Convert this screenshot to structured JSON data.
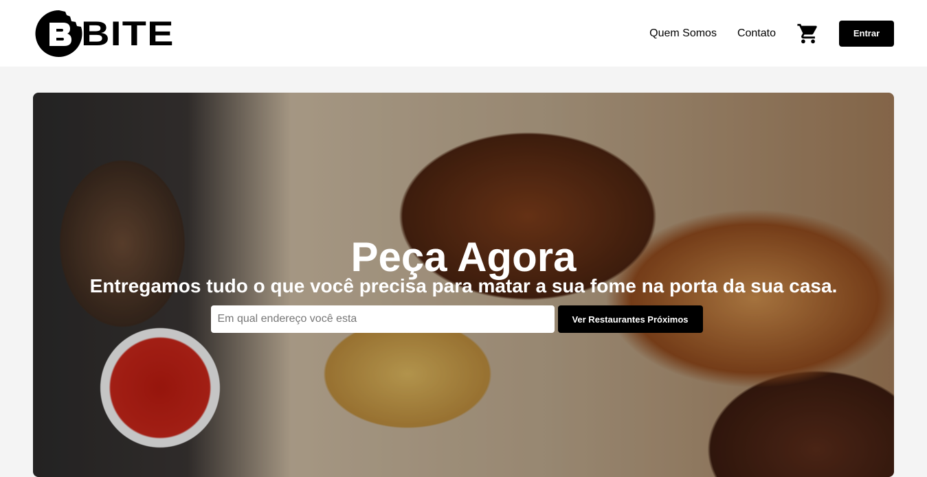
{
  "header": {
    "logo_text": "BITE",
    "nav": [
      {
        "label": "Quem Somos"
      },
      {
        "label": "Contato"
      }
    ],
    "cart_icon": "shopping-cart-icon",
    "login_label": "Entrar"
  },
  "hero": {
    "title": "Peça Agora",
    "subtitle": "Entregamos tudo o que você precisa para matar a sua fome na porta da sua casa.",
    "search_placeholder": "Em qual endereço você esta",
    "search_value": "",
    "search_button": "Ver Restaurantes Próximos"
  }
}
